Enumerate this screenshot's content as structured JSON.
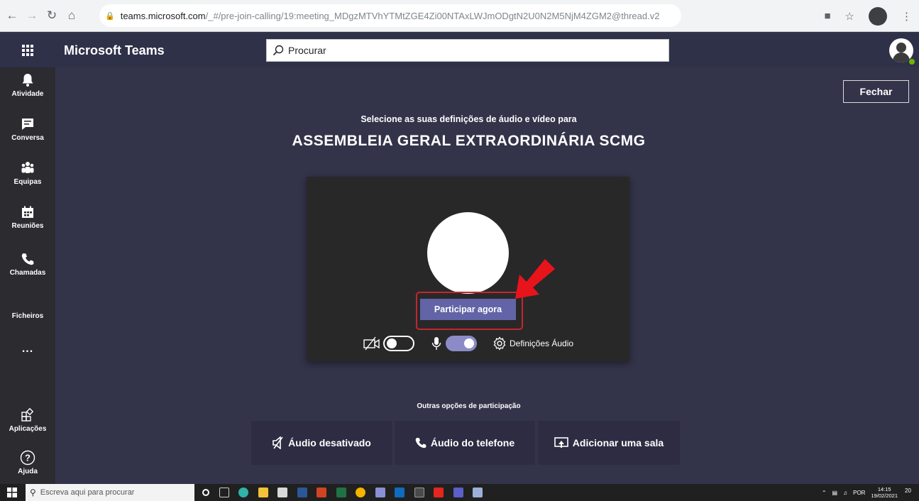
{
  "browser": {
    "url_domain": "teams.microsoft.com",
    "url_path": "/_#/pre-join-calling/19:meeting_MDgzMTVhYTMtZGE4Zi00NTAxLWJmODgtN2U0N2M5NjM4ZGM2@thread.v2"
  },
  "header": {
    "app_name": "Microsoft Teams",
    "search_placeholder": "Procurar"
  },
  "rail": {
    "items": [
      {
        "label": "Atividade"
      },
      {
        "label": "Conversa"
      },
      {
        "label": "Equipas"
      },
      {
        "label": "Reuniões"
      },
      {
        "label": "Chamadas"
      },
      {
        "label": "Ficheiros"
      },
      {
        "label": "..."
      },
      {
        "label": "Aplicações"
      },
      {
        "label": "Ajuda"
      }
    ]
  },
  "main": {
    "close_label": "Fechar",
    "prompt": "Selecione as suas definições de áudio e vídeo para",
    "meeting_title": "ASSEMBLEIA GERAL EXTRAORDINÁRIA SCMG",
    "join_label": "Participar agora",
    "video_enabled": false,
    "mic_enabled": true,
    "audio_settings_label": "Definições Áudio",
    "other_options_title": "Outras opções de participação",
    "options": [
      {
        "label": "Áudio desativado",
        "icon": "speaker-off-icon"
      },
      {
        "label": "Áudio do telefone",
        "icon": "phone-icon"
      },
      {
        "label": "Adicionar uma sala",
        "icon": "cast-icon"
      }
    ]
  },
  "taskbar": {
    "search_placeholder": "Escreva aqui para procurar",
    "language": "POR",
    "time": "14:15",
    "date": "19/02/2021",
    "notification_count": "20"
  },
  "colors": {
    "accent": "#6264a7",
    "highlight_red": "#c4262e",
    "arrow_red": "#e8141c",
    "header_bg": "#2f3149",
    "rail_bg": "#2b2b30",
    "main_bg": "#33344a"
  }
}
